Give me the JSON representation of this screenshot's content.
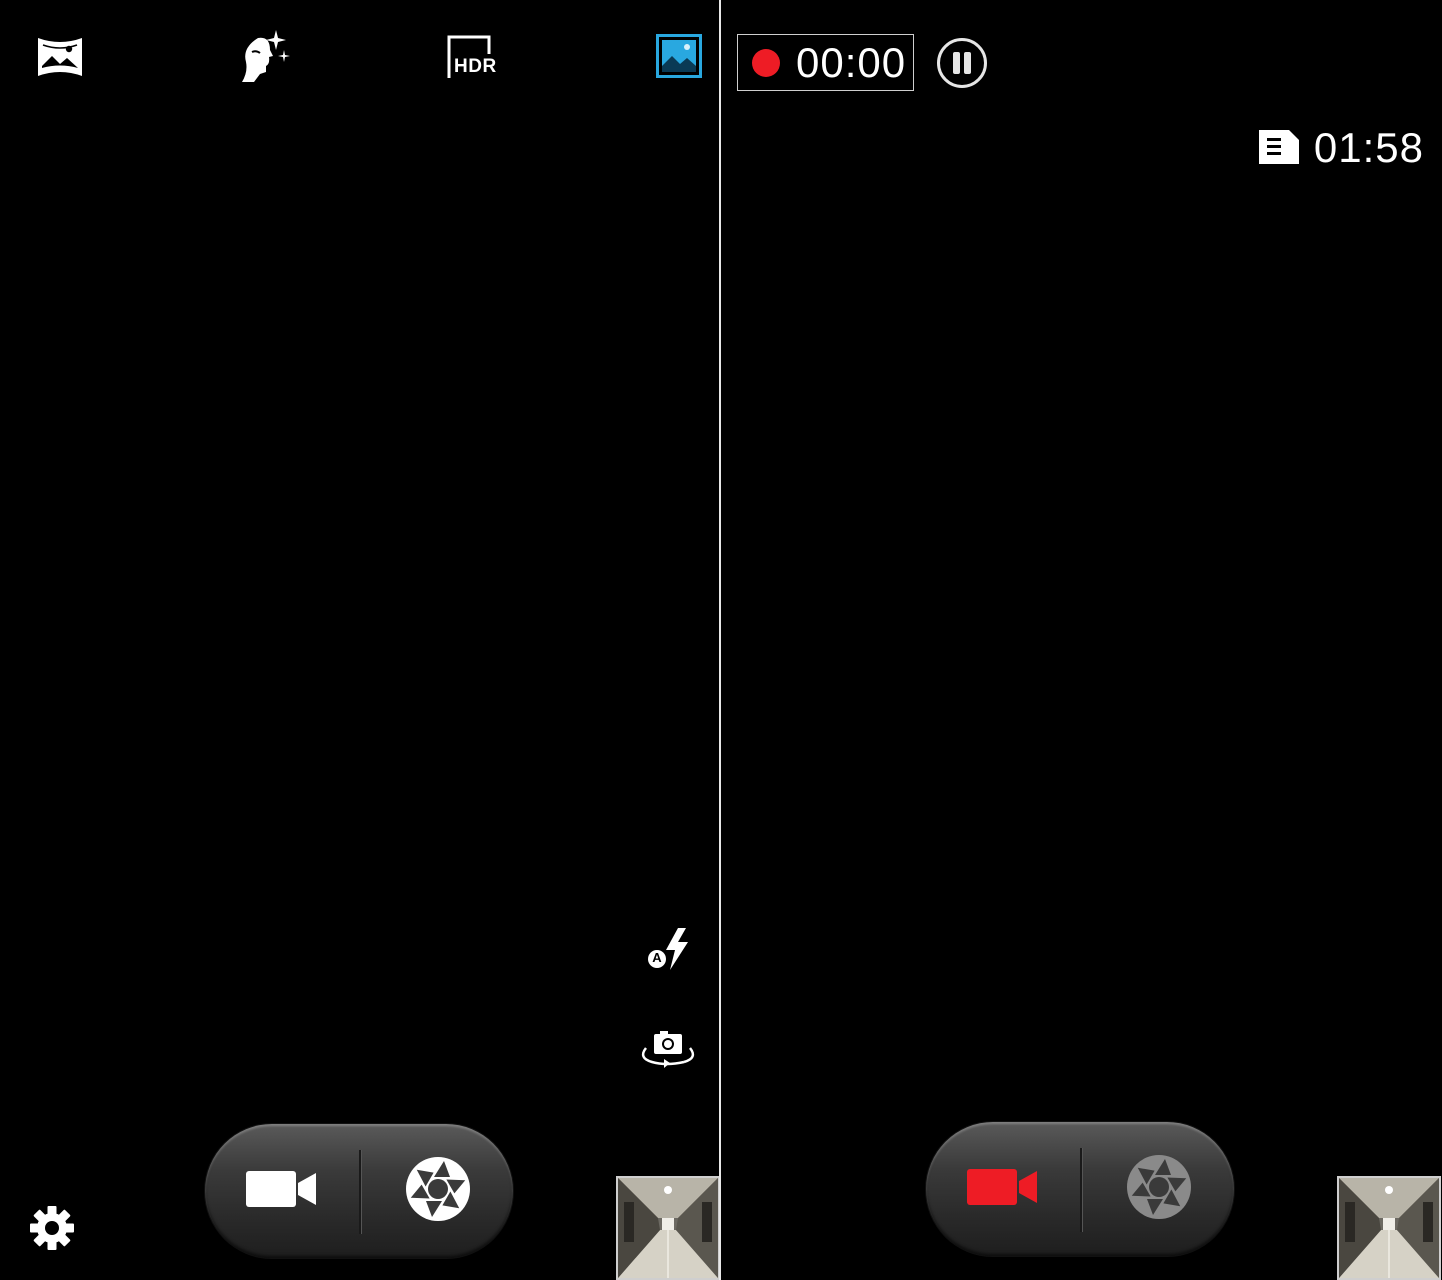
{
  "photo_mode": {
    "top_bar": {
      "panorama_icon": "panorama-icon",
      "beauty_icon": "beauty-face-icon",
      "hdr_label": "HDR",
      "scene_icon": "image-scene-icon"
    },
    "side_controls": {
      "flash_label": "A",
      "flash_icon": "flash-auto-icon",
      "switch_camera_icon": "switch-camera-icon"
    },
    "bottom": {
      "settings_icon": "gear-icon",
      "video_icon": "video-camera-icon",
      "shutter_icon": "shutter-icon",
      "thumbnail": "gallery-thumbnail"
    }
  },
  "video_mode": {
    "recording_time": "00:00",
    "pause_icon": "pause-icon",
    "storage_icon": "sd-card-icon",
    "remaining_time": "01:58",
    "bottom": {
      "video_icon": "video-camera-icon",
      "shutter_icon": "shutter-icon",
      "thumbnail": "gallery-thumbnail"
    }
  },
  "colors": {
    "background": "#000000",
    "accent_blue": "#29a8e0",
    "record_red": "#ee1c25",
    "icon_white": "#ffffff",
    "disabled_gray": "#8a8a8a"
  }
}
